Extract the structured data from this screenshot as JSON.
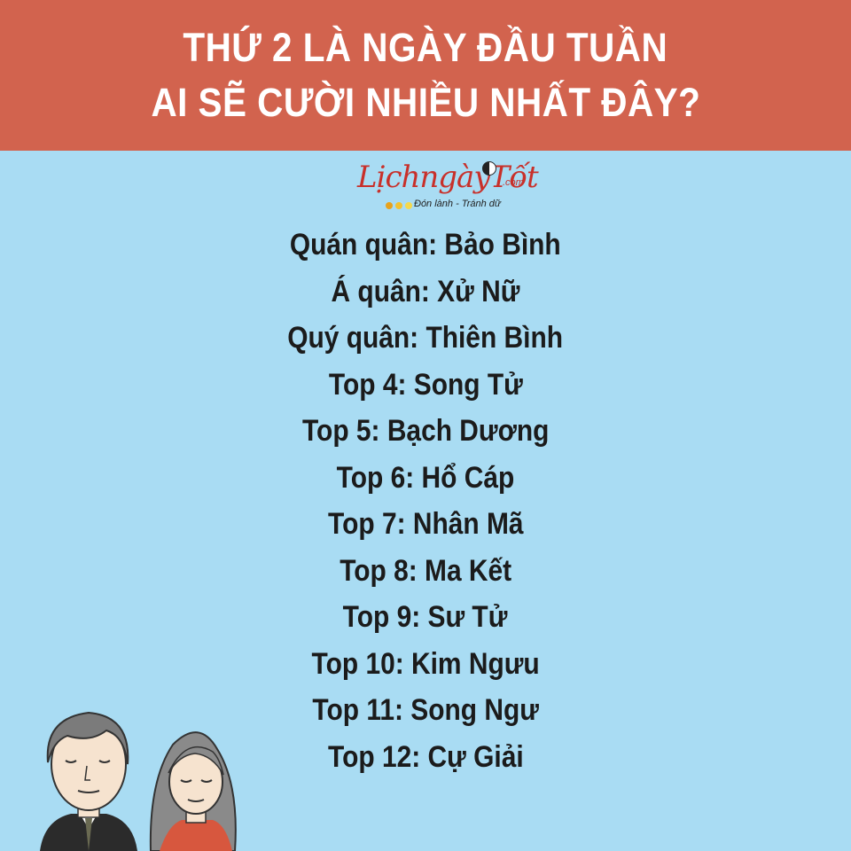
{
  "banner": {
    "line1": "THỨ 2 LÀ NGÀY ĐẦU TUẦN",
    "line2": "AI SẼ CƯỜI NHIỀU NHẤT ĐÂY?"
  },
  "logo": {
    "text": "LịchngàyTốt",
    "domain": ".com",
    "tagline": "Đón lành - Tránh dữ",
    "dot_colors": [
      "#e6a21c",
      "#f2c230",
      "#f5d94c"
    ]
  },
  "ranking": [
    "Quán quân: Bảo Bình",
    "Á quân: Xử Nữ",
    "Quý quân: Thiên Bình",
    "Top 4: Song Tử",
    "Top 5: Bạch Dương",
    "Top 6: Hổ Cáp",
    "Top 7: Nhân Mã",
    "Top 8: Ma Kết",
    "Top 9: Sư Tử",
    "Top 10: Kim Ngưu",
    "Top 11: Song Ngư",
    "Top 12: Cự Giải"
  ],
  "illustration": {
    "icon": "smiling-couple-illustration"
  },
  "colors": {
    "banner": "#d2634e",
    "background": "#a9dcf3",
    "text": "#1b1b1b",
    "logo_red": "#c8302a"
  }
}
